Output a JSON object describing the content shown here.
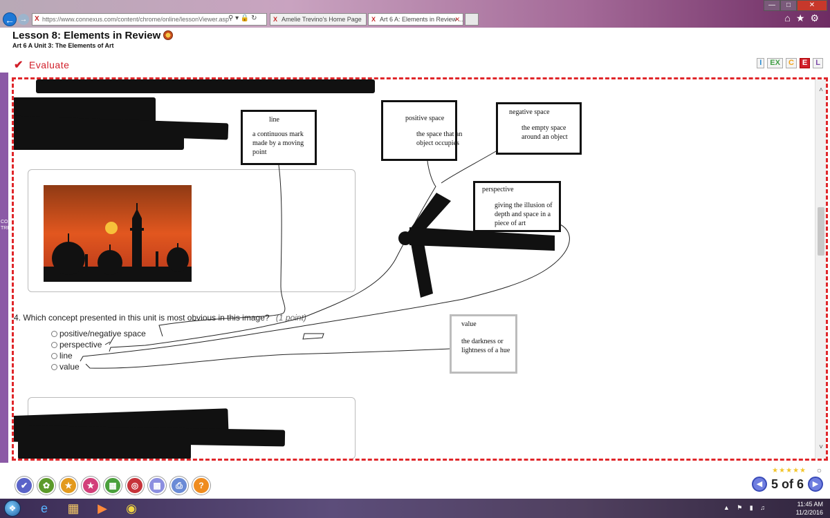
{
  "browser": {
    "url": "https://www.connexus.com/content/chrome/online/lessonViewer.asp",
    "tabs": [
      {
        "title": "Amelie Trevino's Home Page"
      },
      {
        "title": "Art 6 A: Elements in Review ..."
      }
    ]
  },
  "lesson": {
    "title": "Lesson 8: Elements in Review",
    "subtitle": "Art 6 A  Unit 3: The Elements of Art",
    "section": "Evaluate",
    "modes": [
      "I",
      "EX",
      "C",
      "E",
      "L"
    ]
  },
  "sidebar": {
    "label": "COURSE TREE"
  },
  "question": {
    "number": "4.",
    "text": "Which concept presented in this unit is most obvious in this image?",
    "points": "(1 point)",
    "options": [
      "positive/negative space",
      "perspective",
      "line",
      "value"
    ]
  },
  "terms": [
    {
      "term": "line",
      "definition": "a continuous mark made by a moving point"
    },
    {
      "term": "positive space",
      "definition": "the space that an object occupies"
    },
    {
      "term": "negative space",
      "definition": "the empty space around an object"
    },
    {
      "term": "perspective",
      "definition": "giving the illusion of depth and space in a piece of art"
    },
    {
      "term": "value",
      "definition": "the darkness or lightness of a hue"
    }
  ],
  "pager": {
    "text": "5 of 6"
  },
  "clock": {
    "time": "11:45 AM",
    "date": "11/2/2016"
  },
  "icons": {
    "back": "back-arrow-icon",
    "forward": "forward-arrow-icon",
    "home": "home-icon",
    "favorites": "star-icon",
    "settings": "gear-icon",
    "check": "checkmark-icon",
    "prev": "previous-arrow-icon",
    "next": "next-arrow-icon"
  },
  "colors": {
    "accent": "#d11f2a",
    "course_tree": "#8b5aa6",
    "pager": "#6f7ee0"
  }
}
